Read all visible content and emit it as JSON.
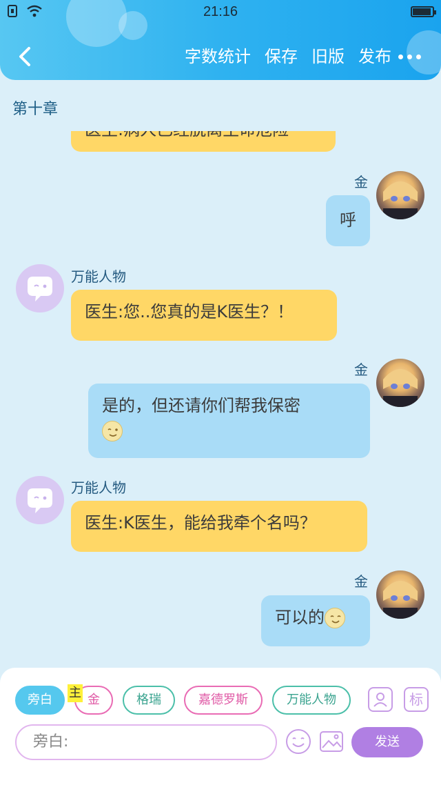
{
  "status_bar": {
    "time": "21:16"
  },
  "header": {
    "actions": [
      "字数统计",
      "保存",
      "旧版",
      "发布"
    ]
  },
  "chapter_title": "第十章",
  "messages": [
    {
      "side": "left",
      "text": "医生:病人已经脱离生命危险"
    },
    {
      "side": "right",
      "sender": "金",
      "text": "呼"
    },
    {
      "side": "left",
      "sender": "万能人物",
      "text": "医生:您..您真的是K医生？！"
    },
    {
      "side": "right",
      "sender": "金",
      "text": "是的，但还请你们帮我保密"
    },
    {
      "side": "left",
      "sender": "万能人物",
      "text": "医生:K医生，能给我牵个名吗？"
    },
    {
      "side": "right",
      "sender": "金",
      "text": "可以的"
    }
  ],
  "bottom": {
    "chips": [
      "旁白",
      "金",
      "格瑞",
      "嘉德罗斯",
      "万能人物"
    ],
    "role_badge": "主",
    "right_icon_label": "标",
    "input_placeholder": "旁白:",
    "send_label": "发送"
  },
  "colors": {
    "header_gradient": [
      "#57c7f2",
      "#1aa3ee"
    ],
    "bubble_left": "#ffd766",
    "bubble_right": "#a9dcf7",
    "send_button": "#b07fe3"
  }
}
